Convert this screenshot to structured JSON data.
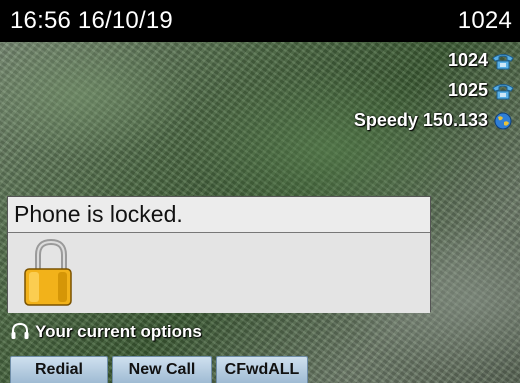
{
  "status_bar": {
    "time_date": "16:56 16/10/19",
    "extension": "1024"
  },
  "lines": [
    {
      "label": "1024",
      "icon": "phone-icon"
    },
    {
      "label": "1025",
      "icon": "phone-icon"
    },
    {
      "label": "Speedy 150.133",
      "icon": "globe-icon"
    }
  ],
  "dialog": {
    "title": "Phone is locked.",
    "icon": "padlock-icon"
  },
  "options": {
    "label": "Your current options",
    "icon": "headset-icon"
  },
  "softkeys": [
    {
      "label": "Redial"
    },
    {
      "label": "New Call"
    },
    {
      "label": "CFwdALL"
    }
  ],
  "colors": {
    "topbar": "#000000",
    "softkey": "#b4cce0",
    "dialog": "#e6e6e6"
  }
}
